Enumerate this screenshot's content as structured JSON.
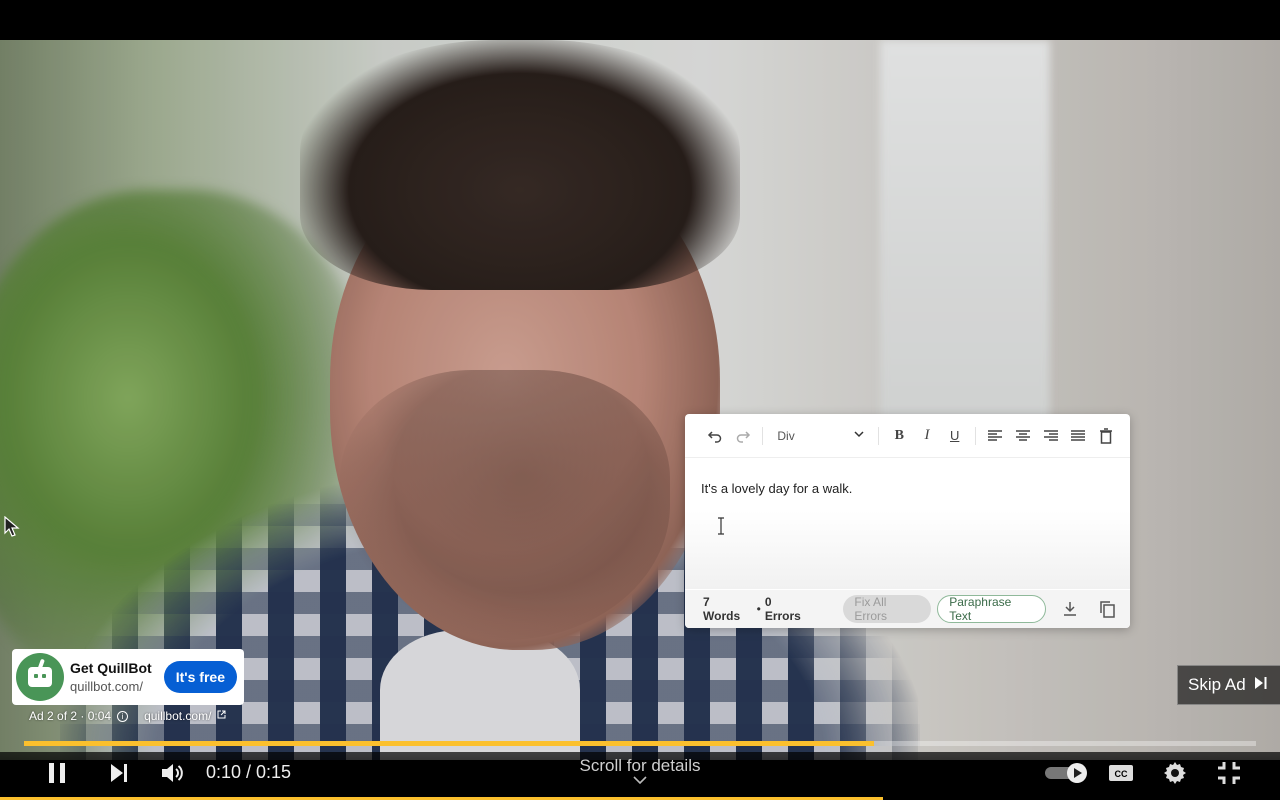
{
  "player": {
    "progress_percent": 69,
    "time_display": "0:10 / 0:15",
    "scroll_hint": "Scroll for details"
  },
  "editor": {
    "format_select": "Div",
    "body_text": "It's a lovely day for a walk.",
    "words_stat": "7 Words",
    "errors_stat": "0 Errors",
    "fix_all_label": "Fix All Errors",
    "paraphrase_label": "Paraphrase Text"
  },
  "ad": {
    "name": "Get QuillBot",
    "url": "quillbot.com/",
    "cta": "It's free",
    "info": "Ad 2 of 2 · 0:04",
    "link": "quillbot.com/",
    "skip_label": "Skip Ad"
  },
  "colors": {
    "progress": "#fbc02d",
    "cta": "#065fd4",
    "quillbot_green": "#499557"
  },
  "icons": [
    "undo-icon",
    "redo-icon",
    "chevron-down-icon",
    "bold-icon",
    "italic-icon",
    "underline-icon",
    "align-left-icon",
    "align-center-icon",
    "align-right-icon",
    "align-justify-icon",
    "trash-icon",
    "download-icon",
    "copy-icon",
    "info-icon",
    "external-link-icon",
    "skip-next-icon",
    "pause-icon",
    "next-icon",
    "volume-icon",
    "autoplay-toggle-icon",
    "captions-icon",
    "settings-icon",
    "exit-fullscreen-icon"
  ]
}
